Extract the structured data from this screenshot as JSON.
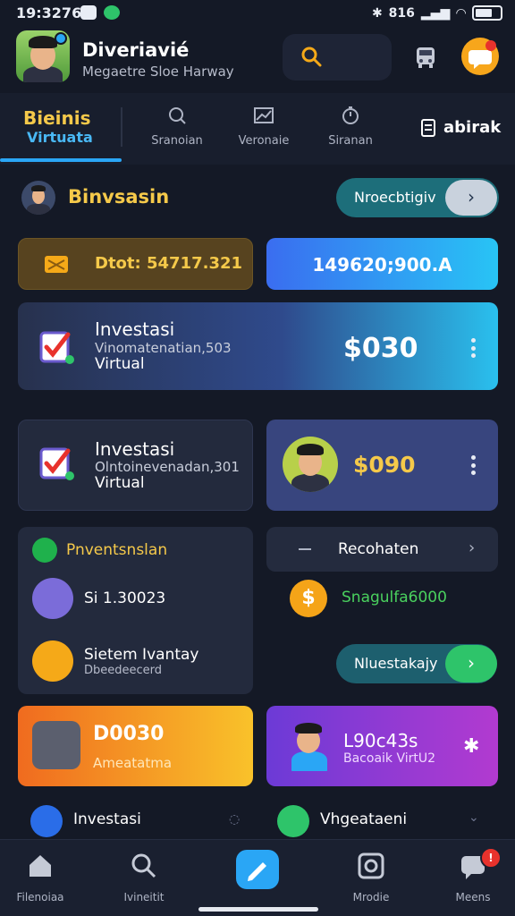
{
  "status_bar": {
    "time": "19:3276",
    "right_text": "816"
  },
  "header": {
    "title": "Diveriavié",
    "subtitle": "Megaetre Sloe Harway"
  },
  "tabs": {
    "active": {
      "line1": "Bieinis",
      "line2": "Virtuata"
    },
    "items": [
      {
        "label": "Sranoian",
        "icon": "search-chart-icon"
      },
      {
        "label": "Veronaie",
        "icon": "stock-chart-icon"
      },
      {
        "label": "Siranan",
        "icon": "clock-icon"
      }
    ],
    "right_label": "abirak"
  },
  "section": {
    "title": "Binvsasin",
    "button_label": "Nroecbtigiv"
  },
  "cards": {
    "gold_text": "Dtot: 54717.321",
    "blue_text": "149620;900.A",
    "wide": {
      "title": "Investasi",
      "sub": "Vinomatenatian,503",
      "sub2": "Virtual",
      "amount": "$030"
    },
    "second": {
      "title": "Investasi",
      "sub": "Olntoinevenadan,301",
      "sub2": "Virtual"
    },
    "indigo_amount": "$090",
    "list": {
      "head": "Pnventsnslan",
      "item1": "Si 1.30023",
      "item2": "Sietem Ivantay",
      "item2_sub": "Dbeedeecerd"
    },
    "right_panel": {
      "head": "Recohaten",
      "coin_label": "Snagulfa6000",
      "button_label": "Nluestakajy"
    },
    "orange": {
      "title": "D0030",
      "sub": "Ameatatma"
    },
    "purple": {
      "title": "L90c43s",
      "sub": "Bacoaik VirtU2"
    },
    "bottom_left": "Investasi",
    "bottom_right": "Vhgeataeni"
  },
  "bottom_nav": [
    {
      "label": "Filenoiaa",
      "icon": "home-icon"
    },
    {
      "label": "Ivineitit",
      "icon": "search-icon"
    },
    {
      "label": "",
      "icon": "edit-icon"
    },
    {
      "label": "Mrodie",
      "icon": "camera-icon"
    },
    {
      "label": "Meens",
      "icon": "chat-icon"
    }
  ],
  "colors": {
    "background": "#141926",
    "accent_blue": "#2aa6f5",
    "accent_gold": "#f5c94a",
    "accent_green": "#2ec46a"
  }
}
